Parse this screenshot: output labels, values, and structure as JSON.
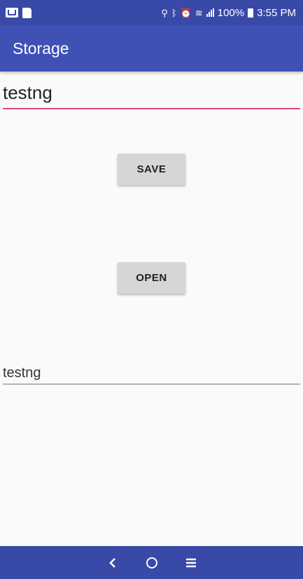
{
  "status_bar": {
    "battery": "100%",
    "time": "3:55 PM",
    "icons": [
      "mail-icon",
      "sd-card-icon",
      "location-icon",
      "bluetooth-icon",
      "alarm-icon",
      "wifi-icon",
      "signal-icon",
      "battery-icon"
    ]
  },
  "app_bar": {
    "title": "Storage"
  },
  "input": {
    "value": "testng"
  },
  "buttons": {
    "save_label": "SAVE",
    "open_label": "OPEN"
  },
  "output": {
    "text": "testng"
  },
  "nav_bar": {
    "icons": [
      "back-icon",
      "home-icon",
      "recents-icon"
    ]
  },
  "colors": {
    "primary": "#3f51b5",
    "primary_dark": "#3849a8",
    "accent": "#e5457f"
  }
}
